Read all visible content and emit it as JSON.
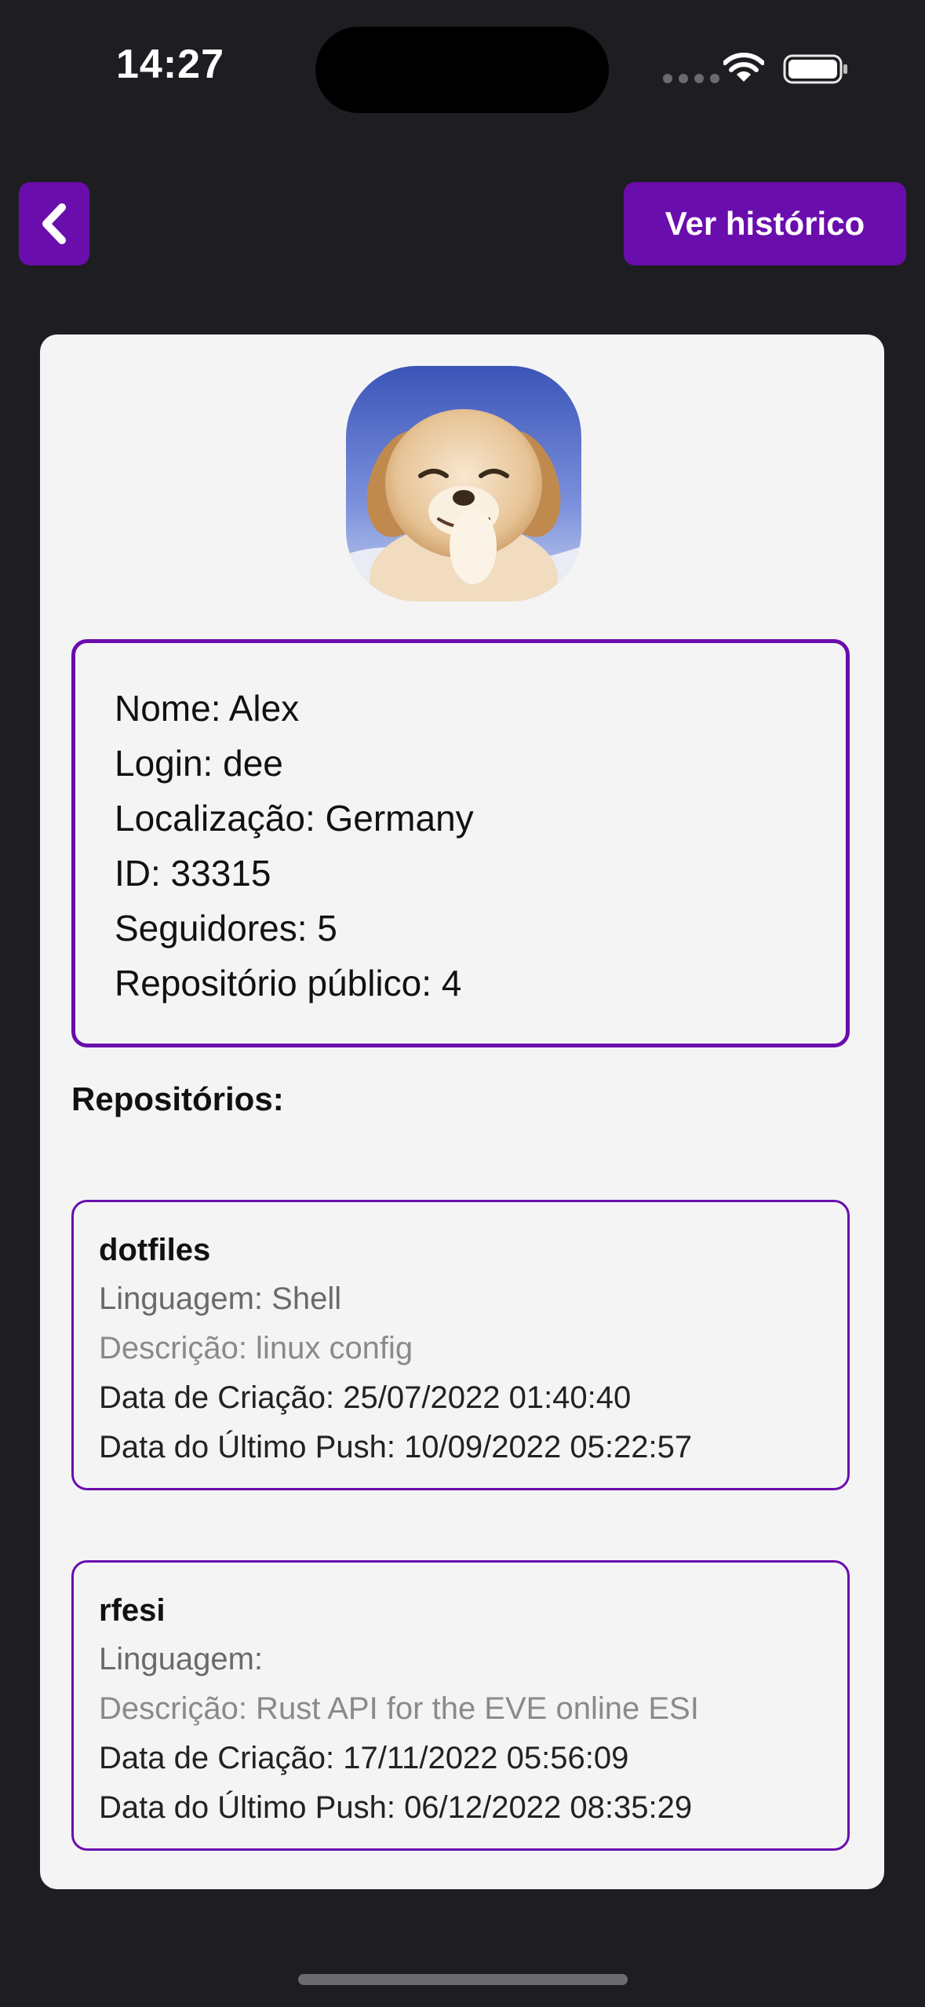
{
  "status_bar": {
    "time": "14:27"
  },
  "header": {
    "back_icon": "chevron-left-icon",
    "history_button_label": "Ver histórico"
  },
  "profile": {
    "avatar_icon": "puppy-avatar",
    "info": [
      "Nome: Alex",
      "Login: dee",
      "Localização: Germany",
      "ID: 33315",
      "Seguidores: 5",
      "Repositório público: 4"
    ]
  },
  "repos_title": "Repositórios:",
  "repos": [
    {
      "name": "dotfiles",
      "language": "Linguagem: Shell",
      "description": "Descrição: linux config",
      "created": "Data de Criação: 25/07/2022 01:40:40",
      "last_push": "Data do Último Push: 10/09/2022 05:22:57"
    },
    {
      "name": "rfesi",
      "language": "Linguagem:",
      "description": "Descrição: Rust API for the EVE online ESI",
      "created": "Data de Criação: 17/11/2022 05:56:09",
      "last_push": "Data do Último Push: 06/12/2022 08:35:29"
    }
  ],
  "colors": {
    "background": "#1e1e22",
    "accent": "#6a0dad",
    "card": "#f4f4f5"
  }
}
